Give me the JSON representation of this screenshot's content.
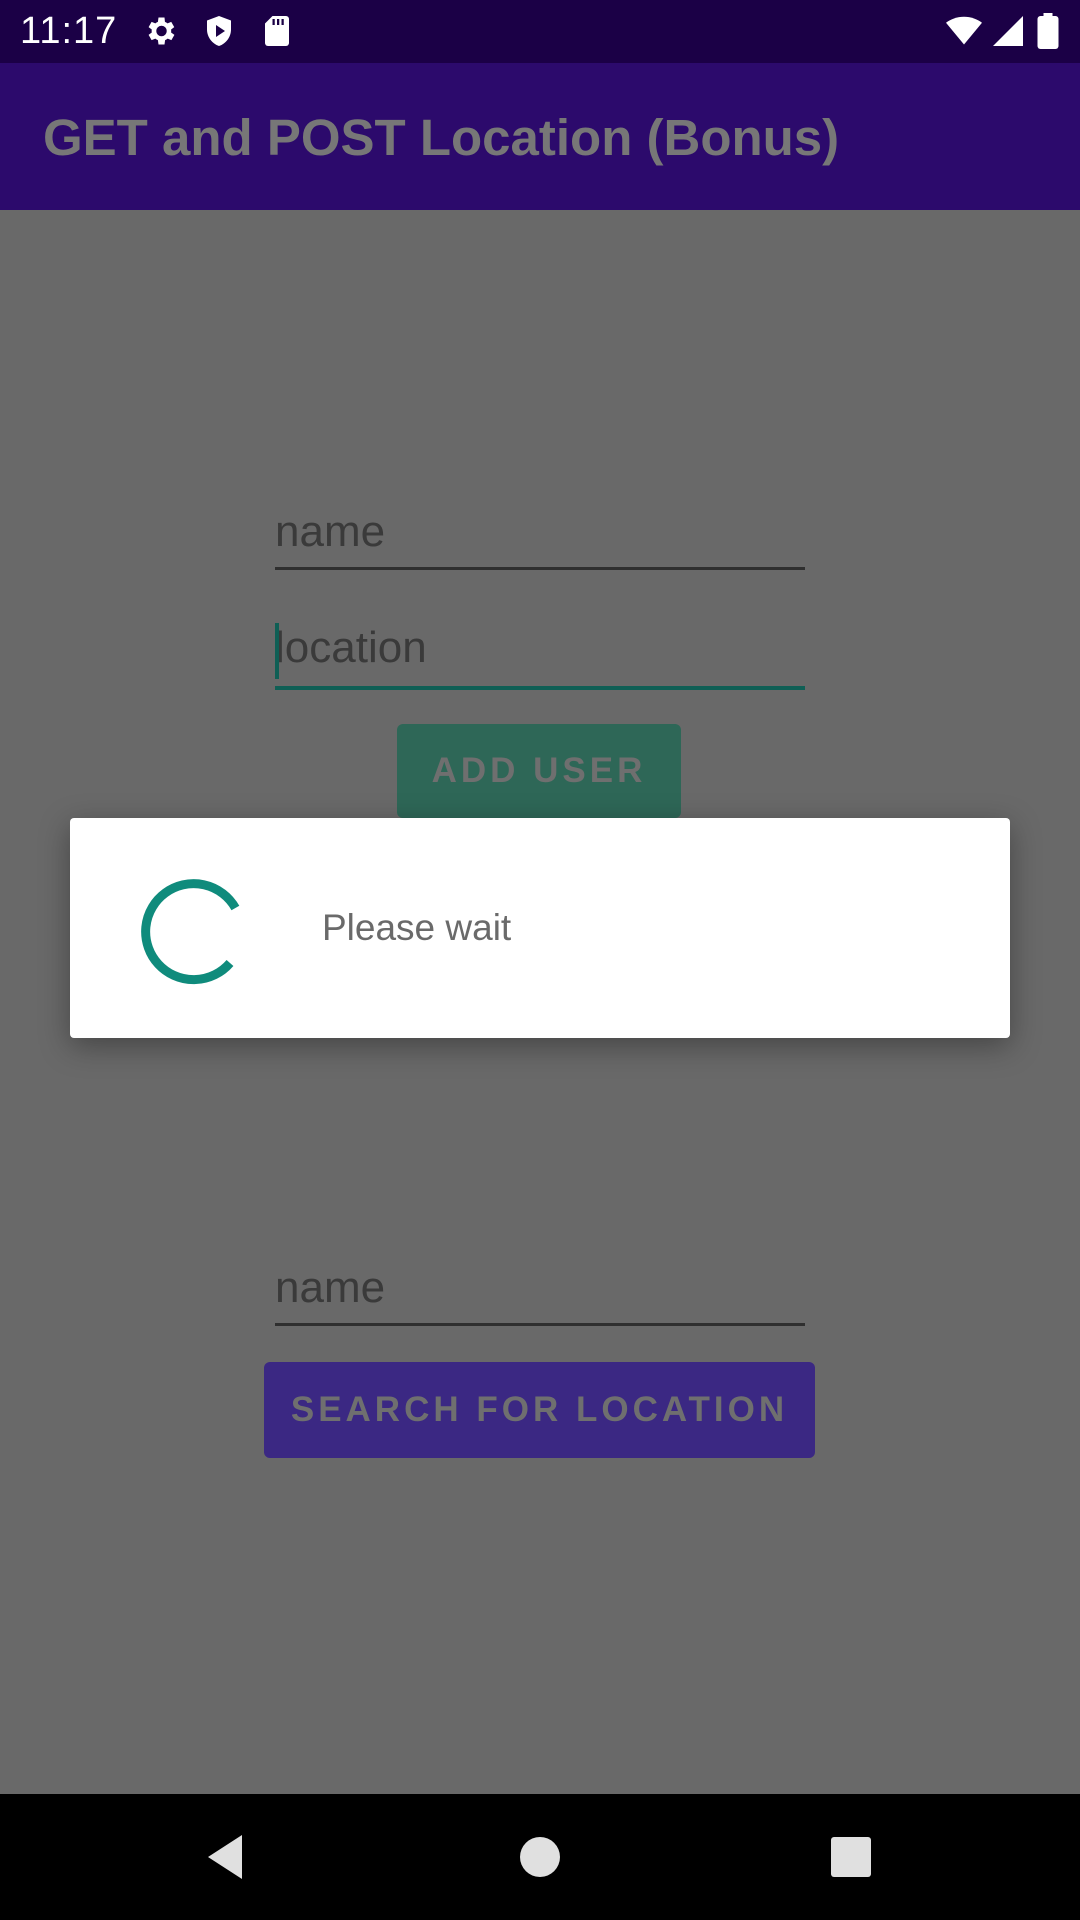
{
  "status_bar": {
    "time": "11:17",
    "icons_left": [
      "gear-icon",
      "shield-play-icon",
      "sd-card-icon"
    ],
    "icons_right": [
      "wifi-icon",
      "cell-signal-icon",
      "battery-icon"
    ]
  },
  "app_bar": {
    "title": "GET and POST Location (Bonus)"
  },
  "form": {
    "name_placeholder": "name",
    "location_placeholder": "location",
    "add_user_label": "ADD USER",
    "search_name_placeholder": "name",
    "search_label": "SEARCH FOR LOCATION"
  },
  "dialog": {
    "message": "Please wait",
    "spinner_color": "#0f8b7c"
  },
  "nav_bar": {
    "items": [
      "back-icon",
      "home-icon",
      "recents-icon"
    ]
  },
  "colors": {
    "status_bar": "#1b0046",
    "app_bar": "#2c0a6c",
    "scrim_background": "#696969",
    "add_button": "#2e6757",
    "search_button": "#3b2883",
    "focused_underline": "#0f5f55"
  }
}
